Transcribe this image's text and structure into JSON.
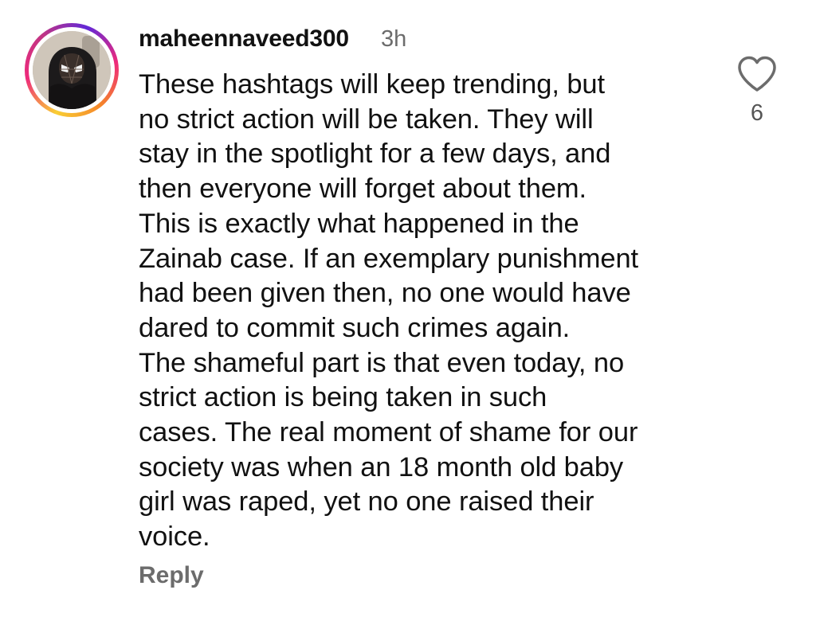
{
  "comment": {
    "username": "maheennaveed300",
    "timestamp": "3h",
    "text": "These hashtags will keep trending, but\nno strict action will be taken. They will\nstay in the spotlight for a few days, and\nthen everyone will forget about them.\nThis is exactly what happened in the\nZainab case. If an exemplary punishment\nhad been given then, no one would have\ndared to commit such crimes again.\nThe shameful part is that even today, no\nstrict action is being taken in such\ncases. The real moment of shame for our\nsociety was when an 18 month old baby\ngirl was raped, yet no one raised their\nvoice.",
    "reply_label": "Reply",
    "like_count": "6",
    "like_icon": "heart-outline-icon"
  },
  "colors": {
    "text": "#111111",
    "secondary_text": "#6c6c6c",
    "story_ring_start": "#f9ce34",
    "story_ring_end": "#ee2a7b"
  }
}
